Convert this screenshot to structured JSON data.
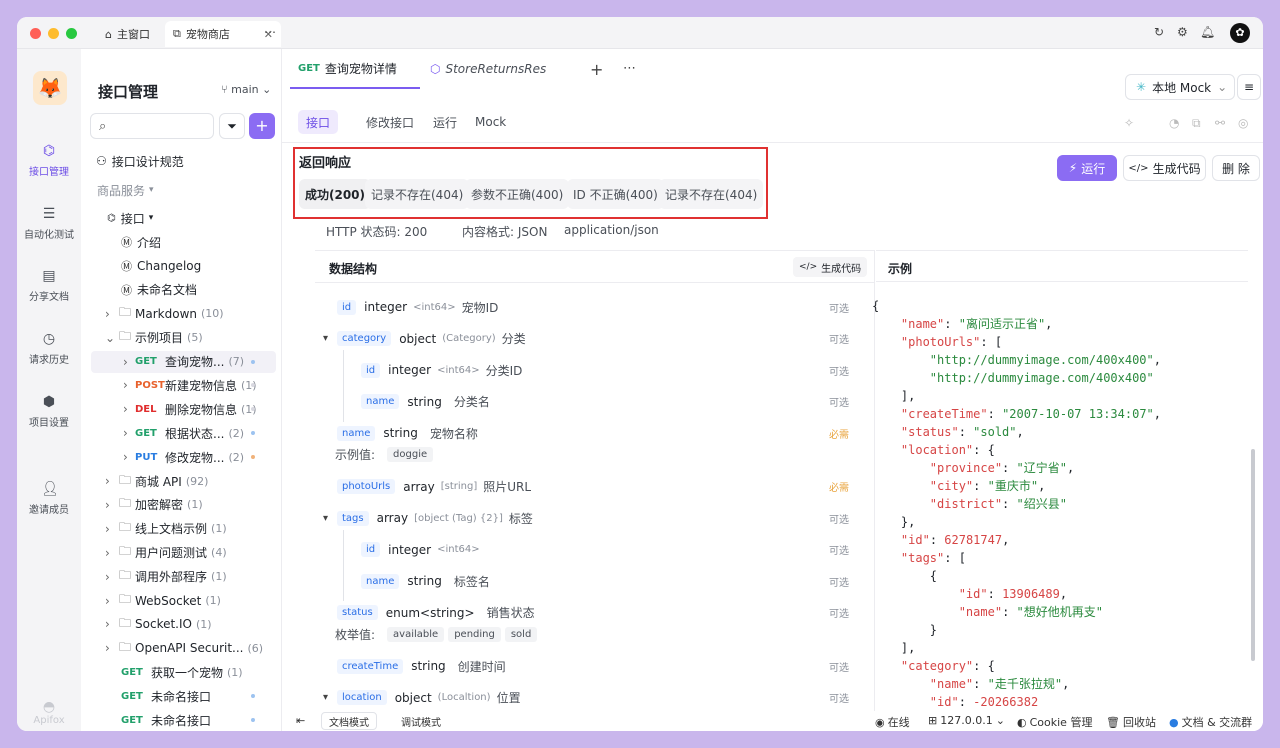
{
  "window": {
    "tabs": [
      {
        "label": "主窗口",
        "icon": "home-icon"
      },
      {
        "label": "宠物商店",
        "icon": "external-link-icon"
      }
    ]
  },
  "rail": {
    "items": [
      {
        "label": "接口管理",
        "icon": "api-icon",
        "active": true
      },
      {
        "label": "自动化测试",
        "icon": "automation-icon"
      },
      {
        "label": "分享文档",
        "icon": "book-icon"
      },
      {
        "label": "请求历史",
        "icon": "history-icon"
      },
      {
        "label": "项目设置",
        "icon": "settings-icon"
      },
      {
        "label": "邀请成员",
        "icon": "invite-user-icon"
      }
    ],
    "brand": "Apifox"
  },
  "sidebar": {
    "title": "接口管理",
    "branch": "main",
    "search_placeholder": "",
    "guide": "接口设计规范",
    "group": "商品服务",
    "root": "接口",
    "items": [
      {
        "label": "介绍",
        "kind": "doc"
      },
      {
        "label": "Changelog",
        "kind": "doc"
      },
      {
        "label": "未命名文档",
        "kind": "doc"
      },
      {
        "label": "Markdown",
        "count": "(10)",
        "kind": "folder"
      },
      {
        "label": "示例项目",
        "count": "(5)",
        "kind": "folder-open"
      },
      {
        "method": "GET",
        "label": "查询宠物...",
        "count": "(7)",
        "kind": "api",
        "selected": true
      },
      {
        "method": "POST",
        "label": "新建宠物信息",
        "count": "(1)",
        "kind": "api"
      },
      {
        "method": "DEL",
        "label": "删除宠物信息",
        "count": "(1)",
        "kind": "api"
      },
      {
        "method": "GET",
        "label": "根据状态...",
        "count": "(2)",
        "kind": "api"
      },
      {
        "method": "PUT",
        "label": "修改宠物...",
        "count": "(2)",
        "kind": "api"
      },
      {
        "label": "商城 API",
        "count": "(92)",
        "kind": "folder"
      },
      {
        "label": "加密解密",
        "count": "(1)",
        "kind": "folder"
      },
      {
        "label": "线上文档示例",
        "count": "(1)",
        "kind": "folder"
      },
      {
        "label": "用户问题测试",
        "count": "(4)",
        "kind": "folder"
      },
      {
        "label": "调用外部程序",
        "count": "(1)",
        "kind": "folder"
      },
      {
        "label": "WebSocket",
        "count": "(1)",
        "kind": "folder"
      },
      {
        "label": "Socket.IO",
        "count": "(1)",
        "kind": "folder"
      },
      {
        "label": "OpenAPI Securit...",
        "count": "(6)",
        "kind": "folder"
      },
      {
        "method": "GET",
        "label": "获取一个宠物",
        "count": "(1)",
        "kind": "api"
      },
      {
        "method": "GET",
        "label": "未命名接口",
        "count": "",
        "kind": "api"
      },
      {
        "method": "GET",
        "label": "未命名接口",
        "count": "",
        "kind": "api"
      }
    ]
  },
  "main": {
    "tabs": [
      {
        "method": "GET",
        "label": "查询宠物详情",
        "active": true
      },
      {
        "label": "StoreReturnsRes",
        "italic": true
      }
    ],
    "env": "本地 Mock",
    "subtabs": [
      "接口",
      "修改接口",
      "运行",
      "Mock"
    ],
    "section_title": "返回响应",
    "response_tabs": [
      "成功(200)",
      "记录不存在(404)",
      "参数不正确(400)",
      "ID 不正确(400)",
      "记录不存在(404)"
    ],
    "buttons": {
      "run": "运行",
      "gen": "生成代码",
      "delete": "删 除"
    },
    "http_status": "HTTP 状态码: 200",
    "content_format": "内容格式: JSON",
    "content_type": "application/json",
    "schema_title": "数据结构",
    "schema_gen": "生成代码",
    "example_title": "示例",
    "fields": [
      {
        "name": "id",
        "type": "integer",
        "sub": "<int64>",
        "desc": "宠物ID",
        "req": "可选",
        "indent": 0
      },
      {
        "name": "category",
        "type": "object",
        "sub": "(Category)",
        "desc": "分类",
        "req": "可选",
        "indent": 0,
        "expand": true
      },
      {
        "name": "id",
        "type": "integer",
        "sub": "<int64>",
        "desc": "分类ID",
        "req": "可选",
        "indent": 1
      },
      {
        "name": "name",
        "type": "string",
        "sub": "",
        "desc": "分类名",
        "req": "可选",
        "indent": 1
      },
      {
        "name": "name",
        "type": "string",
        "sub": "",
        "desc": "宠物名称",
        "req": "必需",
        "indent": 0,
        "example_label": "示例值:",
        "examples": [
          "doggie"
        ]
      },
      {
        "name": "photoUrls",
        "type": "array",
        "sub": "[string]",
        "desc": "照片URL",
        "req": "必需",
        "indent": 0
      },
      {
        "name": "tags",
        "type": "array",
        "sub": "[object (Tag) {2}]",
        "desc": "标签",
        "req": "可选",
        "indent": 0,
        "expand": true
      },
      {
        "name": "id",
        "type": "integer",
        "sub": "<int64>",
        "desc": "",
        "req": "可选",
        "indent": 1
      },
      {
        "name": "name",
        "type": "string",
        "sub": "",
        "desc": "标签名",
        "req": "可选",
        "indent": 1
      },
      {
        "name": "status",
        "type": "enum<string>",
        "sub": "",
        "desc": "销售状态",
        "req": "可选",
        "indent": 0,
        "example_label": "枚举值:",
        "examples": [
          "available",
          "pending",
          "sold"
        ]
      },
      {
        "name": "createTime",
        "type": "string",
        "sub": "",
        "desc": "创建时间",
        "req": "可选",
        "indent": 0
      },
      {
        "name": "location",
        "type": "object",
        "sub": "(Localtion)",
        "desc": "位置",
        "req": "可选",
        "indent": 0,
        "expand": true
      }
    ],
    "example_lines": [
      [
        "{"
      ],
      [
        "    ",
        "k:\"name\"",
        ": ",
        "s:\"离问适示正省\"",
        ","
      ],
      [
        "    ",
        "k:\"photoUrls\"",
        ": ["
      ],
      [
        "        ",
        "s:\"http://dummyimage.com/400x400\"",
        ","
      ],
      [
        "        ",
        "s:\"http://dummyimage.com/400x400\""
      ],
      [
        "    ],"
      ],
      [
        "    ",
        "k:\"createTime\"",
        ": ",
        "s:\"2007-10-07 13:34:07\"",
        ","
      ],
      [
        "    ",
        "k:\"status\"",
        ": ",
        "s:\"sold\"",
        ","
      ],
      [
        "    ",
        "k:\"location\"",
        ": {"
      ],
      [
        "        ",
        "k:\"province\"",
        ": ",
        "s:\"辽宁省\"",
        ","
      ],
      [
        "        ",
        "k:\"city\"",
        ": ",
        "s:\"重庆市\"",
        ","
      ],
      [
        "        ",
        "k:\"district\"",
        ": ",
        "s:\"绍兴县\""
      ],
      [
        "    },"
      ],
      [
        "    ",
        "k:\"id\"",
        ": ",
        "n:62781747",
        ","
      ],
      [
        "    ",
        "k:\"tags\"",
        ": ["
      ],
      [
        "        {"
      ],
      [
        "            ",
        "k:\"id\"",
        ": ",
        "n:13906489",
        ","
      ],
      [
        "            ",
        "k:\"name\"",
        ": ",
        "s:\"想好他机再支\""
      ],
      [
        "        }"
      ],
      [
        "    ],"
      ],
      [
        "    ",
        "k:\"category\"",
        ": {"
      ],
      [
        "        ",
        "k:\"name\"",
        ": ",
        "s:\"走千张拉规\"",
        ","
      ],
      [
        "        ",
        "k:\"id\"",
        ": ",
        "n:-20266382"
      ]
    ]
  },
  "statusbar": {
    "doc_mode": "文档模式",
    "debug_mode": "调试模式",
    "online": "在线",
    "ip": "127.0.0.1",
    "cookie": "Cookie 管理",
    "trash": "回收站",
    "community": "文档 & 交流群"
  },
  "colors": {
    "accent": "#7b5cf0",
    "highlight_box": "#e03131"
  }
}
